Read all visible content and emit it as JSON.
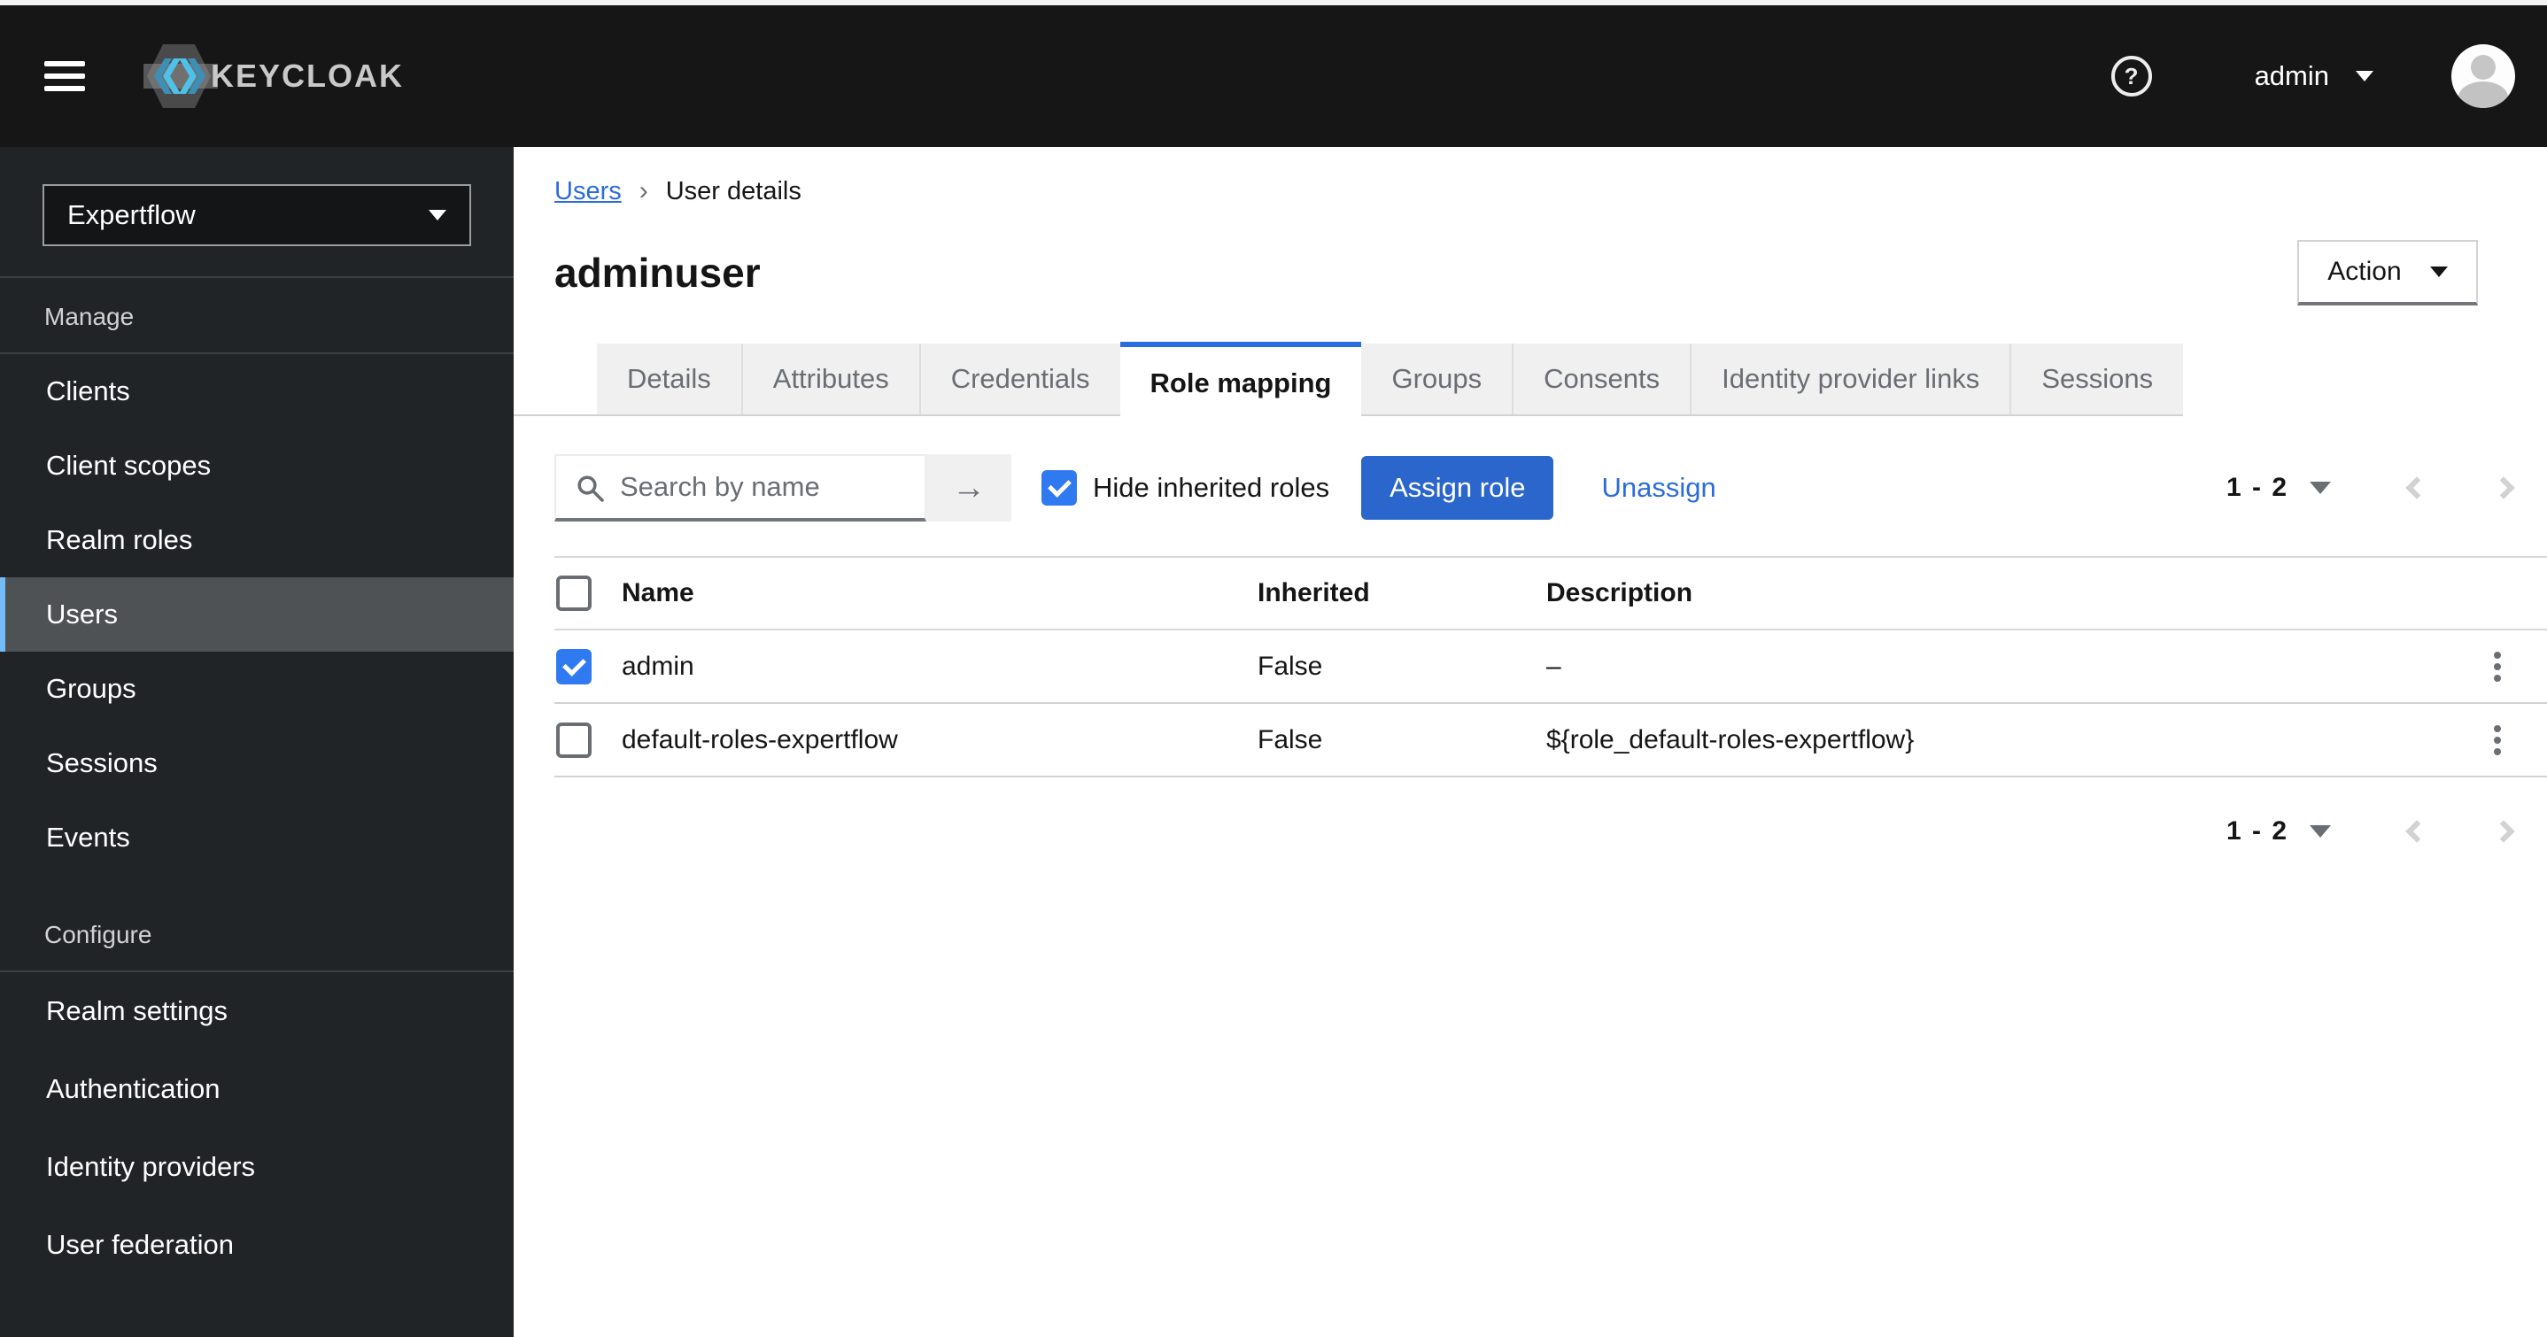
{
  "header": {
    "brand": "KEYCLOAK",
    "help_glyph": "?",
    "username": "admin"
  },
  "sidebar": {
    "realm": "Expertflow",
    "selected_item": "Users",
    "sections": [
      {
        "label": "Manage",
        "items": [
          "Clients",
          "Client scopes",
          "Realm roles",
          "Users",
          "Groups",
          "Sessions",
          "Events"
        ]
      },
      {
        "label": "Configure",
        "items": [
          "Realm settings",
          "Authentication",
          "Identity providers",
          "User federation"
        ]
      }
    ]
  },
  "breadcrumb": {
    "link": "Users",
    "separator": "›",
    "current": "User details"
  },
  "page": {
    "title": "adminuser",
    "action_label": "Action"
  },
  "tabs": {
    "active": "Role mapping",
    "items": [
      "Details",
      "Attributes",
      "Credentials",
      "Role mapping",
      "Groups",
      "Consents",
      "Identity provider links",
      "Sessions"
    ]
  },
  "toolbar": {
    "search_placeholder": "Search by name",
    "search_arrow": "→",
    "hide_inherited_label": "Hide inherited roles",
    "hide_inherited_checked": true,
    "assign_label": "Assign role",
    "unassign_label": "Unassign"
  },
  "pagination": {
    "range": "1 - 2"
  },
  "table": {
    "headers": [
      "Name",
      "Inherited",
      "Description"
    ],
    "rows": [
      {
        "checked": true,
        "name": "admin",
        "inherited": "False",
        "description": "–"
      },
      {
        "checked": false,
        "name": "default-roles-expertflow",
        "inherited": "False",
        "description": "${role_default-roles-expertflow}"
      }
    ]
  },
  "colors": {
    "masthead_bg": "#161616",
    "sidebar_bg": "#212427",
    "selected_nav_bg": "#4f5255",
    "selected_nav_accent": "#73bcf7",
    "primary_button": "#2b66cc",
    "link_blue": "#2b6cd9",
    "checkbox_blue": "#2f79f1",
    "active_tab_accent": "#2a6fdd",
    "muted_text": "#6a6e73",
    "border_gray": "#d2d2d2",
    "inactive_tab_bg": "#f0f0f0"
  }
}
